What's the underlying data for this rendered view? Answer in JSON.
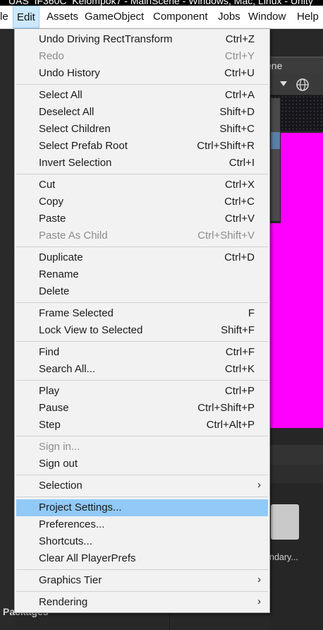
{
  "titlebar": {
    "text": "UAS_IF360C_Kelompok7 - MainScene - Windows, Mac, Linux - Unity"
  },
  "menubar": {
    "items": [
      "le",
      "Edit",
      "Assets",
      "GameObject",
      "Component",
      "Jobs",
      "Window",
      "Help"
    ]
  },
  "scene": {
    "tab_label": "cene"
  },
  "project": {
    "folder_label": "ndary...",
    "packages_label": "Packages"
  },
  "edit_menu": {
    "items": [
      {
        "label": "Undo Driving RectTransform",
        "shortcut": "Ctrl+Z"
      },
      {
        "label": "Redo",
        "shortcut": "Ctrl+Y",
        "disabled": true
      },
      {
        "label": "Undo History",
        "shortcut": "Ctrl+U"
      },
      {
        "label": "Select All",
        "shortcut": "Ctrl+A"
      },
      {
        "label": "Deselect All",
        "shortcut": "Shift+D"
      },
      {
        "label": "Select Children",
        "shortcut": "Shift+C"
      },
      {
        "label": "Select Prefab Root",
        "shortcut": "Ctrl+Shift+R"
      },
      {
        "label": "Invert Selection",
        "shortcut": "Ctrl+I"
      },
      {
        "label": "Cut",
        "shortcut": "Ctrl+X"
      },
      {
        "label": "Copy",
        "shortcut": "Ctrl+C"
      },
      {
        "label": "Paste",
        "shortcut": "Ctrl+V"
      },
      {
        "label": "Paste As Child",
        "shortcut": "Ctrl+Shift+V",
        "disabled": true
      },
      {
        "label": "Duplicate",
        "shortcut": "Ctrl+D"
      },
      {
        "label": "Rename",
        "shortcut": ""
      },
      {
        "label": "Delete",
        "shortcut": ""
      },
      {
        "label": "Frame Selected",
        "shortcut": "F"
      },
      {
        "label": "Lock View to Selected",
        "shortcut": "Shift+F"
      },
      {
        "label": "Find",
        "shortcut": "Ctrl+F"
      },
      {
        "label": "Search All...",
        "shortcut": "Ctrl+K"
      },
      {
        "label": "Play",
        "shortcut": "Ctrl+P"
      },
      {
        "label": "Pause",
        "shortcut": "Ctrl+Shift+P"
      },
      {
        "label": "Step",
        "shortcut": "Ctrl+Alt+P"
      },
      {
        "label": "Sign in...",
        "shortcut": "",
        "disabled": true
      },
      {
        "label": "Sign out",
        "shortcut": ""
      },
      {
        "label": "Selection",
        "shortcut": "",
        "submenu": true
      },
      {
        "label": "Project Settings...",
        "shortcut": "",
        "highlighted": true
      },
      {
        "label": "Preferences...",
        "shortcut": ""
      },
      {
        "label": "Shortcuts...",
        "shortcut": ""
      },
      {
        "label": "Clear All PlayerPrefs",
        "shortcut": ""
      },
      {
        "label": "Graphics Tier",
        "shortcut": "",
        "submenu": true
      },
      {
        "label": "Rendering",
        "shortcut": "",
        "submenu": true
      }
    ],
    "submenu_arrow": "›"
  }
}
